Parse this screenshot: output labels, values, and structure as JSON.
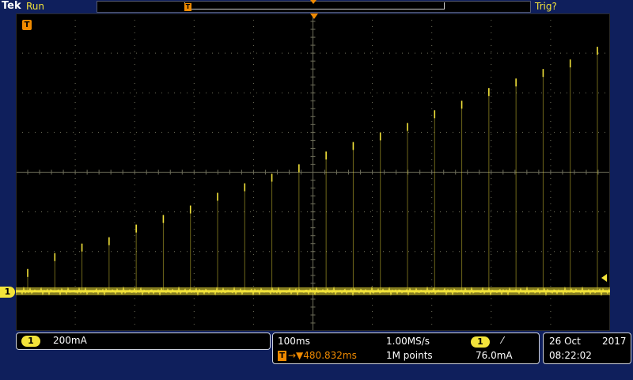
{
  "header": {
    "brand": "Tek",
    "run_status": "Run",
    "trigger_status": "Trig?",
    "record_t_symbol": "T"
  },
  "screen": {
    "trigger_corner_symbol": "T",
    "channel_marker": "1"
  },
  "channel_panel": {
    "channel": "1",
    "scale": "200mA"
  },
  "timebase_panel": {
    "time_per_div": "100ms",
    "sample_rate": "1.00MS/s",
    "trigger_symbol": "T",
    "trigger_position": "→▼480.832ms",
    "record_length": "1M points",
    "trigger_channel": "1",
    "trigger_slope": "⁄",
    "trigger_level": "76.0mA"
  },
  "date_panel": {
    "date_day_month": "26 Oct",
    "year": "2017",
    "time": "08:22:02"
  },
  "colors": {
    "trace": "#f3e33a",
    "accent_orange": "#f08a00",
    "background": "#0f1f5c",
    "graticule": "#6e6e5a"
  },
  "waveform": {
    "baseline_fraction": 0.875,
    "pulse_heights_fraction": [
      0.07,
      0.12,
      0.15,
      0.17,
      0.21,
      0.24,
      0.27,
      0.31,
      0.34,
      0.37,
      0.4,
      0.44,
      0.47,
      0.5,
      0.53,
      0.57,
      0.6,
      0.64,
      0.67,
      0.7,
      0.73,
      0.77
    ]
  }
}
